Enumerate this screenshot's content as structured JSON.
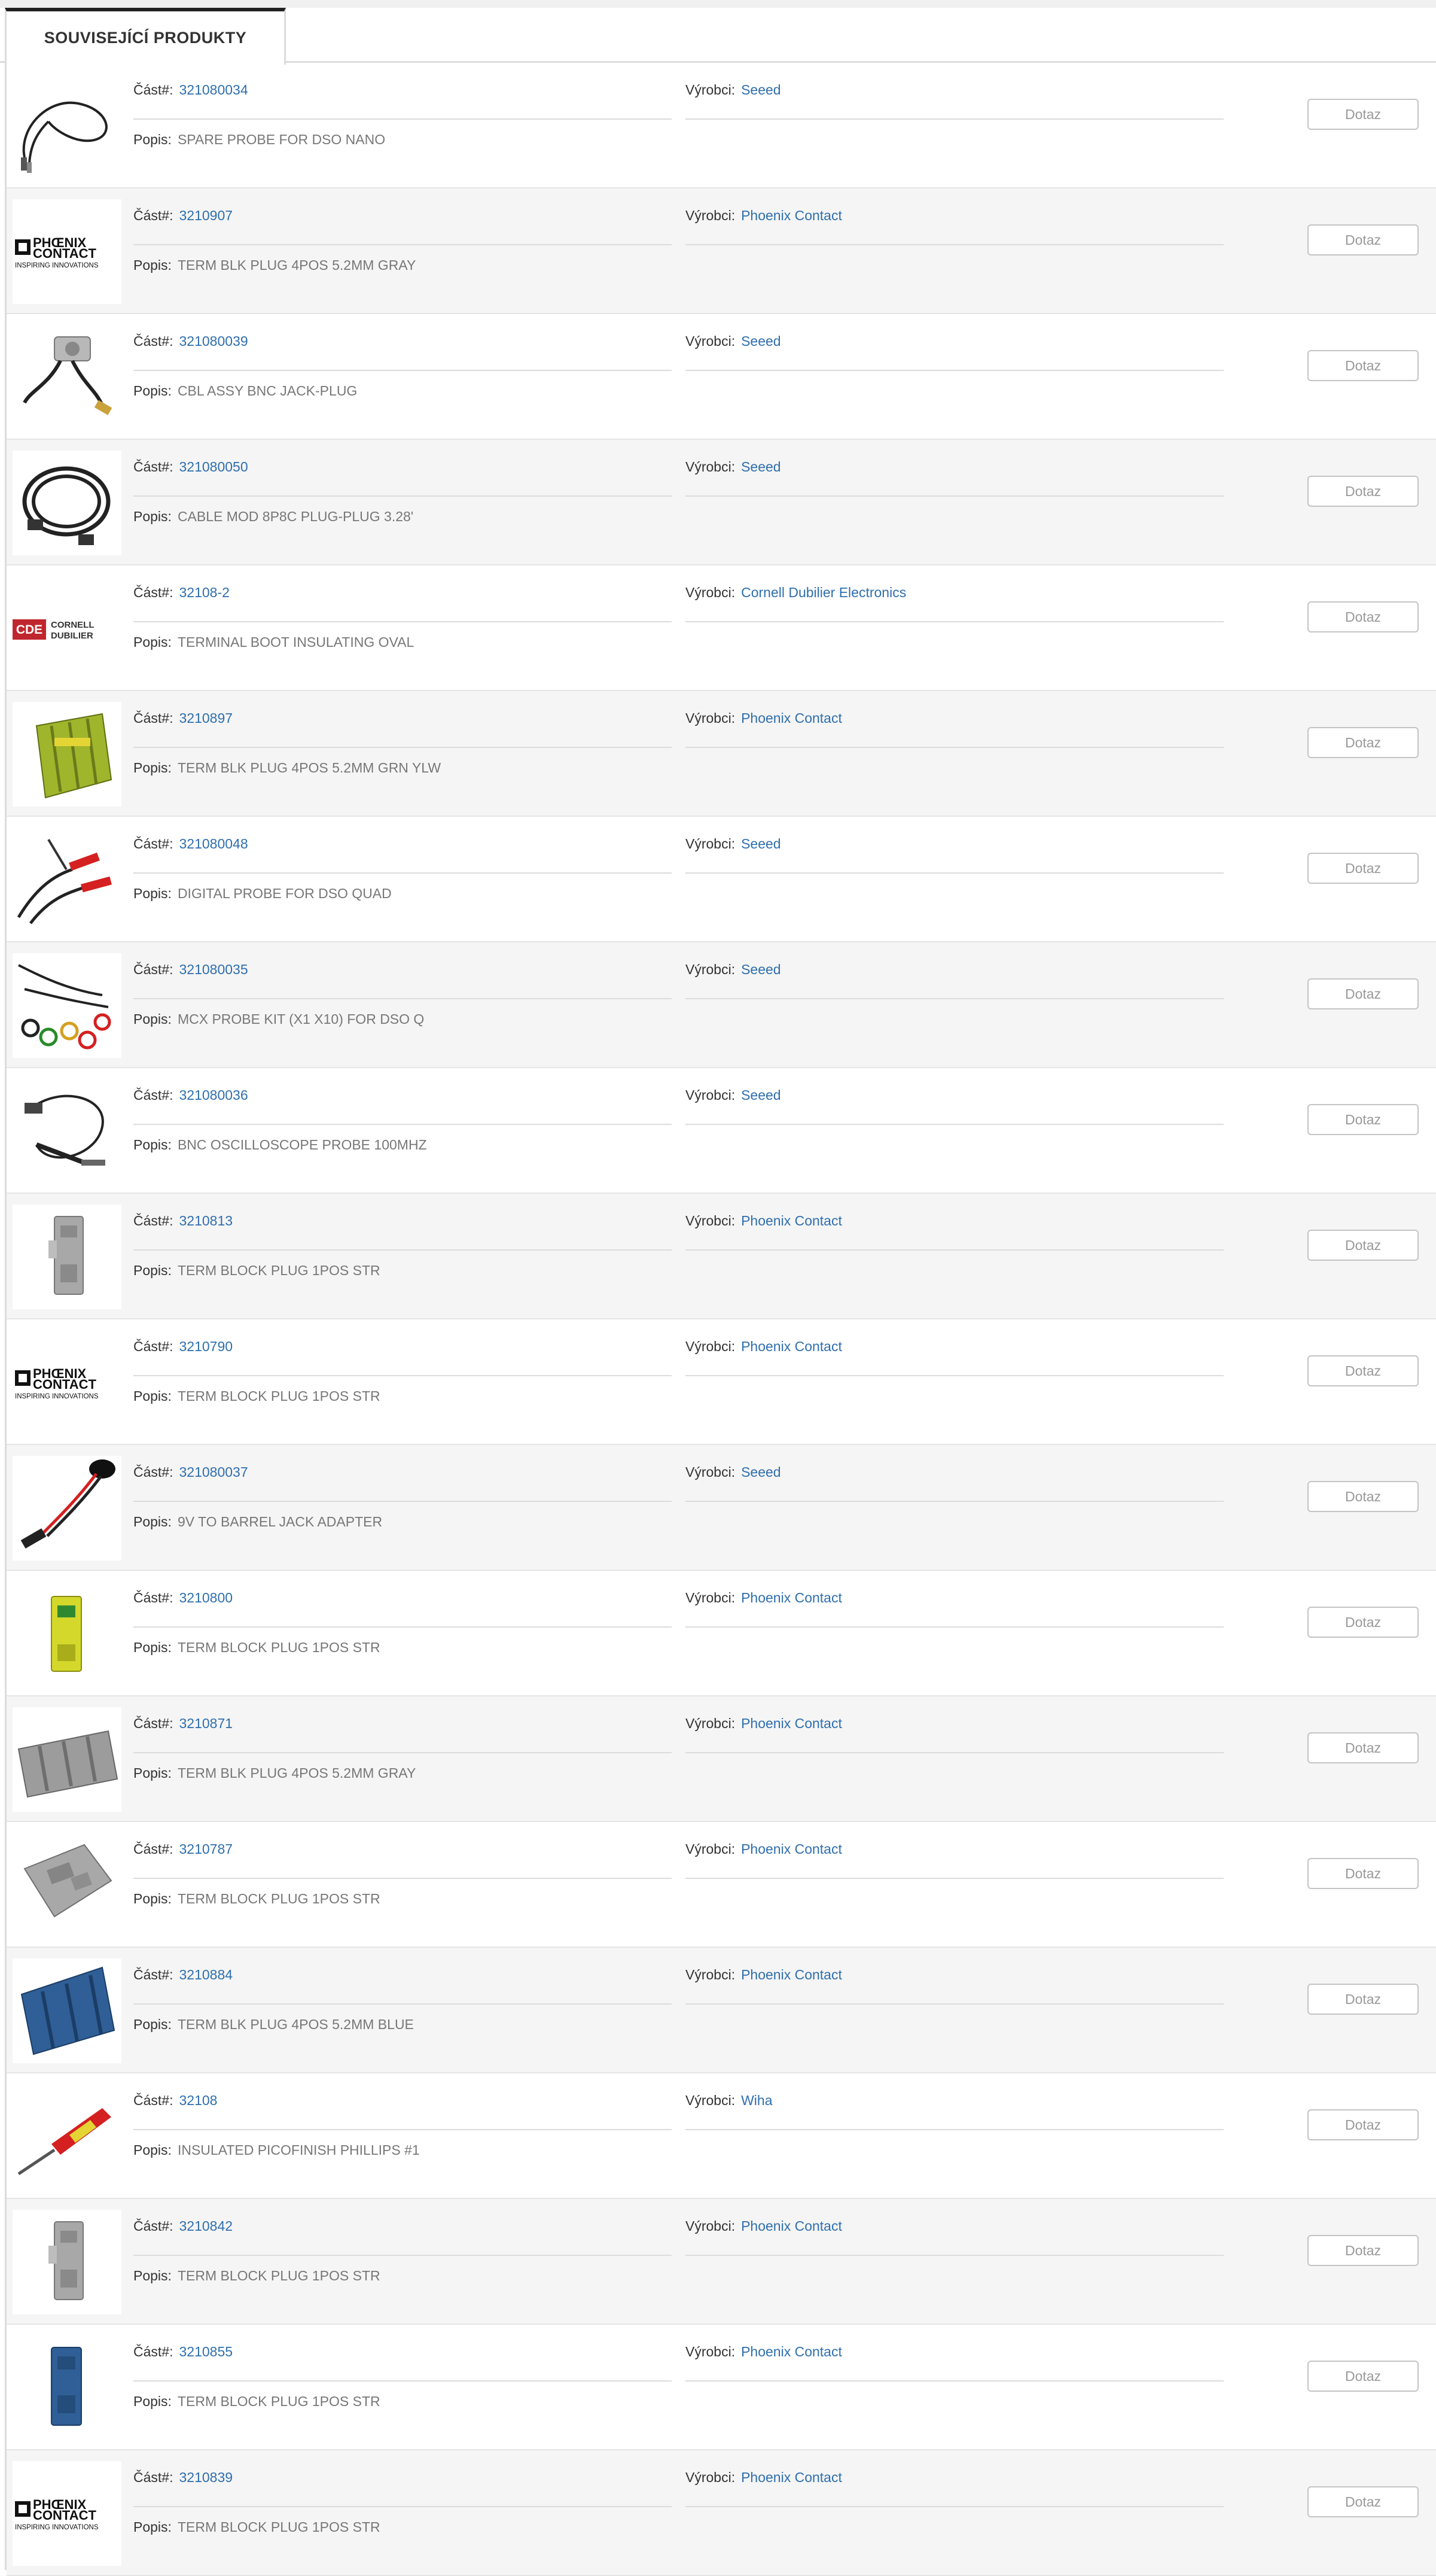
{
  "tab": {
    "label": "SOUVISEJÍCÍ PRODUKTY"
  },
  "labels": {
    "part": "Část#:",
    "manufacturer": "Výrobci:",
    "description": "Popis:",
    "button": "Dotaz"
  },
  "logos": {
    "phoenix": {
      "line1": "PHŒNIX",
      "line2": "CONTACT",
      "tagline": "INSPIRING INNOVATIONS"
    },
    "cde": {
      "mark": "CDE",
      "line1": "CORNELL",
      "line2": "DUBILIER"
    }
  },
  "products": [
    {
      "part": "321080034",
      "manufacturer": "Seeed",
      "description": "SPARE PROBE FOR DSO NANO",
      "image": "probe-cable-icon"
    },
    {
      "part": "3210907",
      "manufacturer": "Phoenix Contact",
      "description": "TERM BLK PLUG 4POS 5.2MM GRAY",
      "image": "phoenix-logo"
    },
    {
      "part": "321080039",
      "manufacturer": "Seeed",
      "description": "CBL ASSY BNC JACK-PLUG",
      "image": "bnc-cable-icon"
    },
    {
      "part": "321080050",
      "manufacturer": "Seeed",
      "description": "CABLE MOD 8P8C PLUG-PLUG 3.28'",
      "image": "ethernet-cable-icon"
    },
    {
      "part": "32108-2",
      "manufacturer": "Cornell Dubilier Electronics",
      "description": "TERMINAL BOOT INSULATING OVAL",
      "image": "cde-logo"
    },
    {
      "part": "3210897",
      "manufacturer": "Phoenix Contact",
      "description": "TERM BLK PLUG 4POS 5.2MM GRN YLW",
      "image": "terminal-block-green-icon"
    },
    {
      "part": "321080048",
      "manufacturer": "Seeed",
      "description": "DIGITAL PROBE FOR DSO QUAD",
      "image": "digital-probe-icon"
    },
    {
      "part": "321080035",
      "manufacturer": "Seeed",
      "description": "MCX PROBE KIT (X1 X10) FOR DSO Q",
      "image": "probe-kit-icon"
    },
    {
      "part": "321080036",
      "manufacturer": "Seeed",
      "description": "BNC OSCILLOSCOPE PROBE 100MHZ",
      "image": "oscilloscope-probe-icon"
    },
    {
      "part": "3210813",
      "manufacturer": "Phoenix Contact",
      "description": "TERM BLOCK PLUG 1POS STR",
      "image": "terminal-plug-gray-icon"
    },
    {
      "part": "3210790",
      "manufacturer": "Phoenix Contact",
      "description": "TERM BLOCK PLUG 1POS STR",
      "image": "phoenix-logo"
    },
    {
      "part": "321080037",
      "manufacturer": "Seeed",
      "description": "9V TO BARREL JACK ADAPTER",
      "image": "battery-adapter-icon"
    },
    {
      "part": "3210800",
      "manufacturer": "Phoenix Contact",
      "description": "TERM BLOCK PLUG 1POS STR",
      "image": "terminal-plug-yellow-icon"
    },
    {
      "part": "3210871",
      "manufacturer": "Phoenix Contact",
      "description": "TERM BLK PLUG 4POS 5.2MM GRAY",
      "image": "terminal-block-gray-icon"
    },
    {
      "part": "3210787",
      "manufacturer": "Phoenix Contact",
      "description": "TERM BLOCK PLUG 1POS STR",
      "image": "terminal-plug-gray-angled-icon"
    },
    {
      "part": "3210884",
      "manufacturer": "Phoenix Contact",
      "description": "TERM BLK PLUG 4POS 5.2MM BLUE",
      "image": "terminal-block-blue-icon"
    },
    {
      "part": "32108",
      "manufacturer": "Wiha",
      "description": "INSULATED PICOFINISH PHILLIPS #1",
      "image": "screwdriver-icon"
    },
    {
      "part": "3210842",
      "manufacturer": "Phoenix Contact",
      "description": "TERM BLOCK PLUG 1POS STR",
      "image": "terminal-plug-gray-icon"
    },
    {
      "part": "3210855",
      "manufacturer": "Phoenix Contact",
      "description": "TERM BLOCK PLUG 1POS STR",
      "image": "terminal-plug-blue-icon"
    },
    {
      "part": "3210839",
      "manufacturer": "Phoenix Contact",
      "description": "TERM BLOCK PLUG 1POS STR",
      "image": "phoenix-logo"
    }
  ],
  "colors": {
    "link": "#2f6fae",
    "row_alt": "#f5f5f5",
    "cde_red": "#c0262d"
  }
}
